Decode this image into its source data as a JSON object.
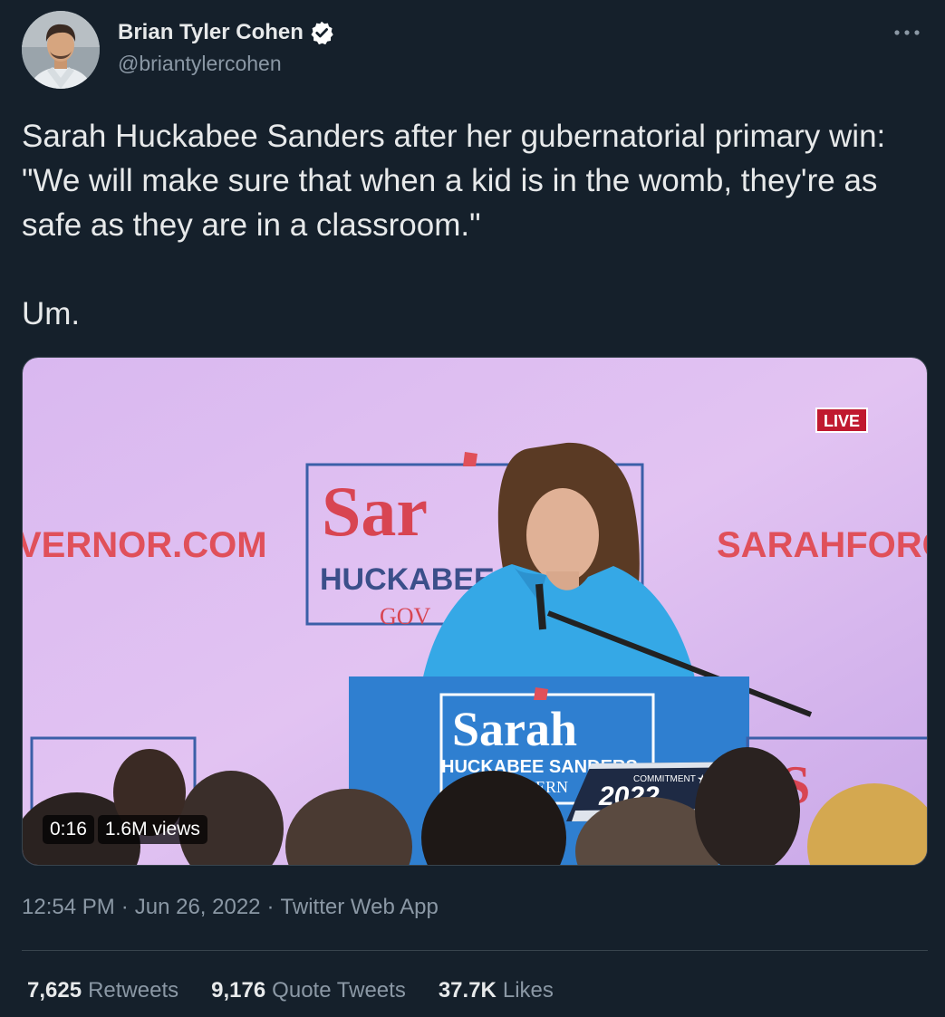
{
  "author": {
    "name": "Brian Tyler Cohen",
    "handle": "@briantylercohen",
    "verified": true,
    "verified_color": "#ffffff"
  },
  "tweet": {
    "text": "Sarah Huckabee Sanders after her gubernatorial primary win: \"We will make sure that when a kid is in the womb, they're as safe as they are in a classroom.\"\n\nUm."
  },
  "media": {
    "type": "video",
    "duration": "0:16",
    "views": "1.6M views",
    "scene": {
      "live_badge": "LIVE",
      "left_banner": "VERNOR.COM",
      "right_banner": "SARAHFORGO",
      "sign_main": "Sar",
      "sign_sub": "HUCKABEE",
      "sign_gov": "GOV",
      "podium_name": "Sarah",
      "podium_sub": "HUCKABEE SANDERS",
      "podium_gov": "ERN",
      "overlay_small": "COMMITMENT",
      "overlay_year": "2022"
    }
  },
  "meta": {
    "time": "12:54 PM",
    "date": "Jun 26, 2022",
    "source": "Twitter Web App",
    "separator": "·"
  },
  "stats": {
    "retweets_count": "7,625",
    "retweets_label": "Retweets",
    "quotes_count": "9,176",
    "quotes_label": "Quote Tweets",
    "likes_count": "37.7K",
    "likes_label": "Likes"
  },
  "colors": {
    "background": "#15202b",
    "text_primary": "#e7e9ea",
    "text_secondary": "#8b98a5",
    "divider": "#38444d"
  },
  "icons": {
    "more": "more-horizontal-icon",
    "verified": "verified-badge-icon"
  }
}
